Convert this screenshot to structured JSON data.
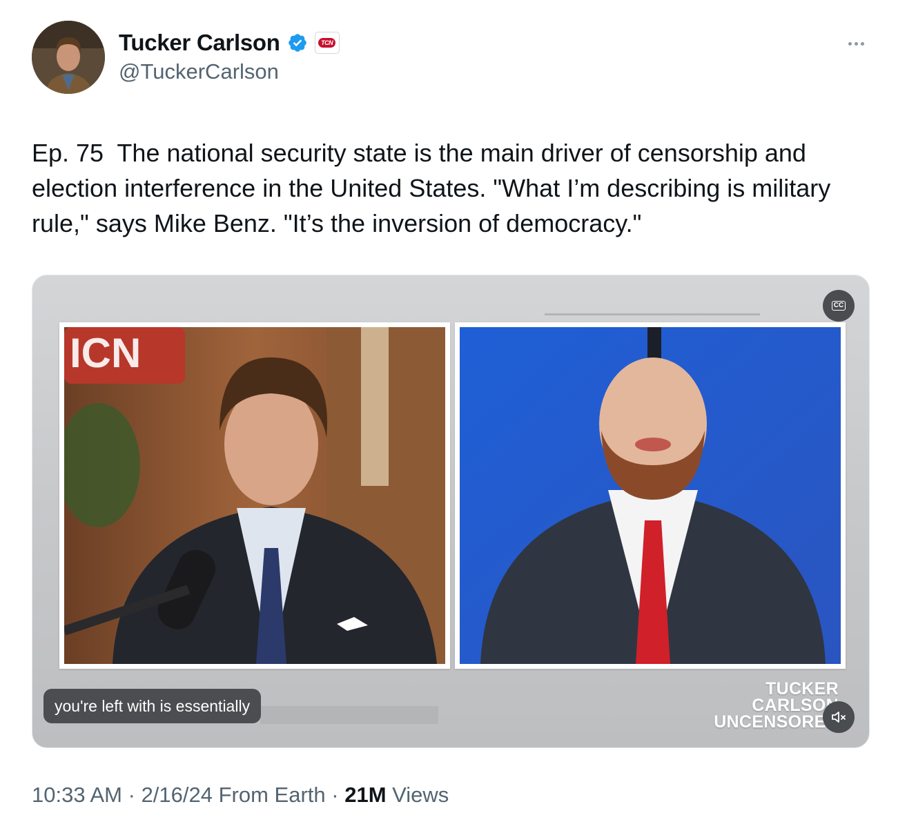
{
  "author": {
    "display_name": "Tucker Carlson",
    "handle": "@TuckerCarlson",
    "affiliate_badge": "TCN",
    "verified_color": "#1d9bf0"
  },
  "tweet": {
    "text": "Ep. 75  The national security state is the main driver of censorship and election interference in the United States. \"What I’m describing is military rule,\" says Mike Benz. \"It’s the inversion of democracy.\""
  },
  "video": {
    "caption": "you're left with is essentially",
    "cc_label": "CC",
    "left_frame_sign": "ICN",
    "brand_lines": [
      "TUCKER",
      "CARLSON",
      "UNCENSORED"
    ],
    "muted": true
  },
  "meta": {
    "time": "10:33 AM",
    "date": "2/16/24",
    "source": "From Earth",
    "views_count": "21M",
    "views_label": "Views",
    "separator": "·"
  },
  "icons": {
    "more": "more-horizontal-icon",
    "verified": "verified-badge-icon",
    "mute": "speaker-muted-icon",
    "cc": "closed-captions-icon"
  }
}
